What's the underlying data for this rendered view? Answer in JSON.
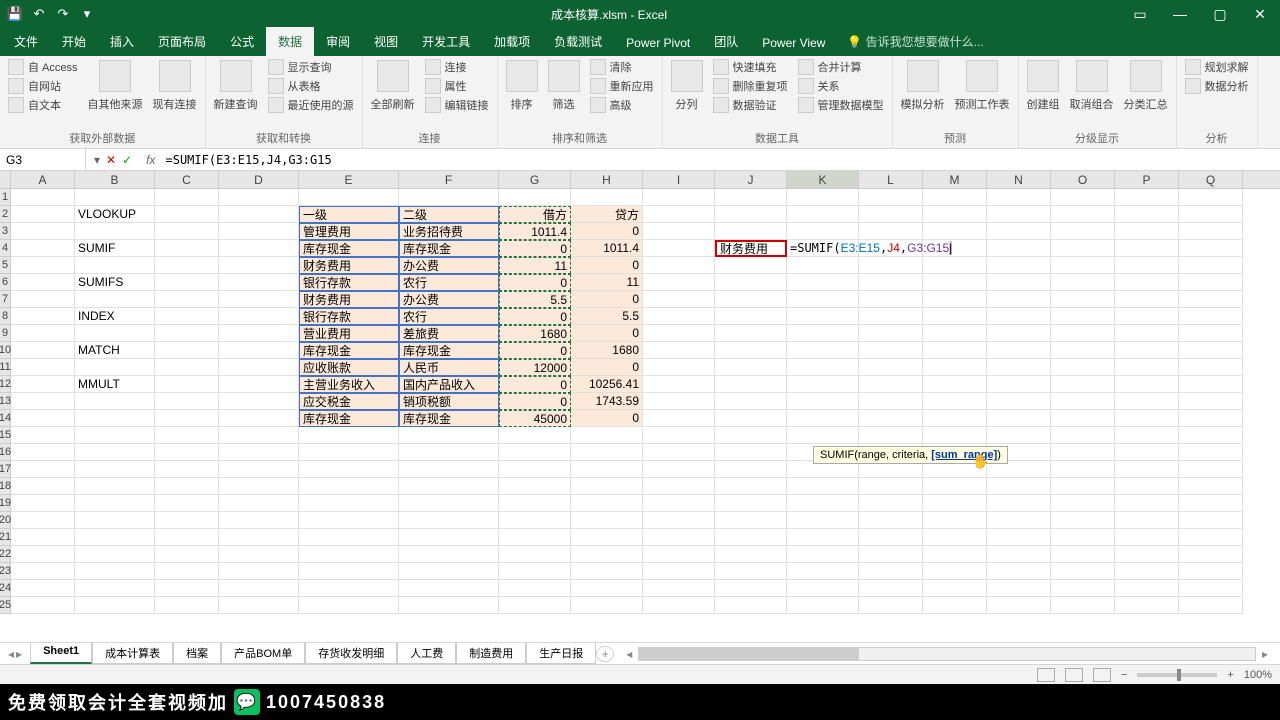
{
  "titlebar": {
    "title": "成本核算.xlsm - Excel"
  },
  "tabs": [
    "文件",
    "开始",
    "插入",
    "页面布局",
    "公式",
    "数据",
    "审阅",
    "视图",
    "开发工具",
    "加载项",
    "负载测试",
    "Power Pivot",
    "团队",
    "Power View"
  ],
  "active_tab": 5,
  "tell_me": "告诉我您想要做什么...",
  "ribbon": {
    "g1": {
      "label": "获取外部数据",
      "items": [
        "自 Access",
        "自网站",
        "自文本"
      ],
      "big": [
        "自其他来源",
        "现有连接"
      ]
    },
    "g2": {
      "label": "获取和转换",
      "big": [
        "新建查询"
      ],
      "items": [
        "显示查询",
        "从表格",
        "最近使用的源"
      ]
    },
    "g3": {
      "label": "连接",
      "big": [
        "全部刷新"
      ],
      "items": [
        "连接",
        "属性",
        "编辑链接"
      ]
    },
    "g4": {
      "label": "排序和筛选",
      "big": [
        "排序",
        "筛选"
      ],
      "items": [
        "清除",
        "重新应用",
        "高级"
      ]
    },
    "g5": {
      "label": "数据工具",
      "big": [
        "分列"
      ],
      "items": [
        "快速填充",
        "删除重复项",
        "数据验证",
        "合并计算",
        "关系",
        "管理数据模型"
      ]
    },
    "g6": {
      "label": "预测",
      "big": [
        "模拟分析",
        "预测工作表"
      ]
    },
    "g7": {
      "label": "分级显示",
      "big": [
        "创建组",
        "取消组合",
        "分类汇总"
      ]
    },
    "g8": {
      "label": "分析",
      "items": [
        "规划求解",
        "数据分析"
      ]
    }
  },
  "namebox": "G3",
  "formula": "=SUMIF(E3:E15,J4,G3:G15",
  "columns": [
    "A",
    "B",
    "C",
    "D",
    "E",
    "F",
    "G",
    "H",
    "I",
    "J",
    "K",
    "L",
    "M",
    "N",
    "O",
    "P",
    "Q"
  ],
  "rownums": [
    1,
    2,
    3,
    4,
    5,
    6,
    7,
    8,
    9,
    10,
    11,
    12,
    13,
    14,
    15,
    16,
    17,
    18,
    19,
    20,
    21,
    22,
    23,
    24,
    25
  ],
  "colwidths": [
    "cA",
    "cB",
    "cC",
    "cD",
    "cE",
    "cF",
    "cG",
    "cH",
    "cI",
    "cJ",
    "cK",
    "cL",
    "cM",
    "cN",
    "cO",
    "cP",
    "cQ"
  ],
  "cells": {
    "B2": "VLOOKUP",
    "B4": "SUMIF",
    "B6": "SUMIFS",
    "B8": "INDEX",
    "B10": "MATCH",
    "B12": "MMULT",
    "E2": "一级",
    "F2": "二级",
    "G2": "借方",
    "H2": "贷方",
    "E3": "管理费用",
    "F3": " 业务招待费",
    "G3": "1011.4",
    "H3": "0",
    "E4": "库存现金",
    "F4": "库存现金",
    "G4": "0",
    "H4": "1011.4",
    "E5": "财务费用",
    "F5": "办公费",
    "G5": "11",
    "H5": "0",
    "E6": "银行存款",
    "F6": "农行",
    "G6": "0",
    "H6": "11",
    "E7": "财务费用",
    "F7": "办公费",
    "G7": "5.5",
    "H7": "0",
    "E8": "银行存款",
    "F8": "农行",
    "G8": "0",
    "H8": "5.5",
    "E9": "营业费用",
    "F9": "差旅费",
    "G9": "1680",
    "H9": "0",
    "E10": "库存现金",
    "F10": "库存现金",
    "G10": "0",
    "H10": "1680",
    "E11": "应收账款",
    "F11": "人民币",
    "G11": "12000",
    "H11": "0",
    "E12": "主营业务收入",
    "F12": "国内产品收入",
    "G12": "0",
    "H12": "10256.41",
    "E13": "应交税金",
    "F13": "  销项税额",
    "G13": "0",
    "H13": "1743.59",
    "E14": "库存现金",
    "F14": "库存现金",
    "G14": "45000",
    "H14": "0",
    "J4": "财务费用"
  },
  "k4_formula": {
    "prefix": "=SUMIF(",
    "r1": "E3:E15",
    "c1": ",",
    "r2": "J4",
    "c2": ",",
    "r3": "G3:G15"
  },
  "tooltip": {
    "text": "SUMIF(range, criteria, ",
    "arg": "[sum_range]",
    "end": ")"
  },
  "sheets": [
    "Sheet1",
    "成本计算表",
    "档案",
    "产品BOM单",
    "存货收发明细",
    "人工费",
    "制造费用",
    "生产日报"
  ],
  "active_sheet": 0,
  "zoom": "100%",
  "footer": {
    "text": "免费领取会计全套视频加",
    "id": "1007450838"
  }
}
